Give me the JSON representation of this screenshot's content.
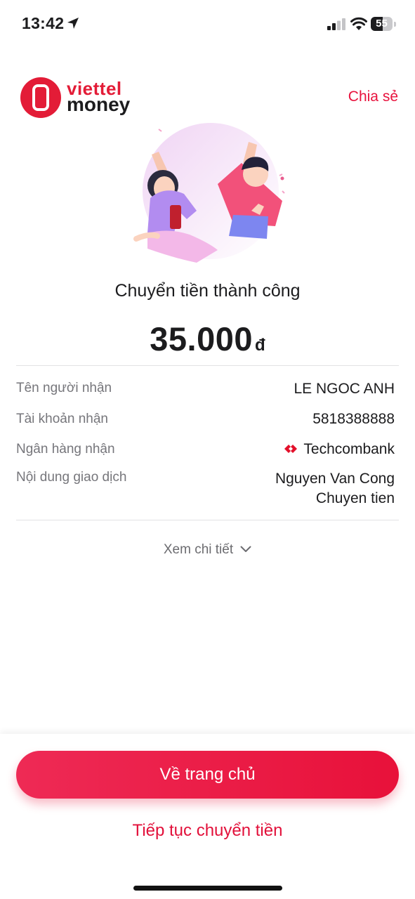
{
  "status_bar": {
    "time": "13:42",
    "battery": "55",
    "battery_level": 0.55
  },
  "header": {
    "brand_line1": "viettel",
    "brand_line2": "money",
    "share_label": "Chia sẻ"
  },
  "result": {
    "title": "Chuyển tiền thành công",
    "amount": "35.000",
    "currency": "đ"
  },
  "details": [
    {
      "label": "Tên người nhận",
      "value": "LE NGOC ANH"
    },
    {
      "label": "Tài khoản nhận",
      "value": "5818388888"
    },
    {
      "label": "Ngân hàng nhận",
      "value": "Techcombank"
    },
    {
      "label": "Nội dung giao dịch",
      "value_line1": "Nguyen Van Cong",
      "value_line2": "Chuyen tien"
    }
  ],
  "see_more_label": "Xem chi tiết",
  "actions": {
    "home_label": "Về trang chủ",
    "continue_label": "Tiếp tục chuyển tiền"
  },
  "colors": {
    "brand_red": "#e8123d",
    "text_dark": "#1c1c1e",
    "text_muted": "#76767b"
  },
  "icons": [
    "location-arrow-icon",
    "signal-icon",
    "wifi-icon",
    "battery-icon",
    "viettel-logo-icon",
    "techcombank-logo-icon",
    "chevron-down-icon"
  ]
}
